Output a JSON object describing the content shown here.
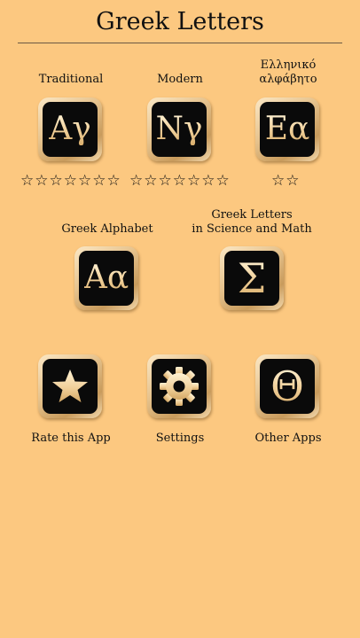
{
  "header": {
    "title": "Greek Letters"
  },
  "row1": [
    {
      "label": "Traditional",
      "glyph": "Αγ",
      "stars": "☆☆☆☆☆☆☆"
    },
    {
      "label": "Modern",
      "glyph": "Νγ",
      "stars": "☆☆☆☆☆☆☆"
    },
    {
      "label_line1": "Ελληνικό",
      "label_line2": "αλφάβητο",
      "glyph": "Εα",
      "stars": "☆☆"
    }
  ],
  "row2": [
    {
      "label": "Greek Alphabet",
      "glyph": "Αα"
    },
    {
      "label_line1": "Greek Letters",
      "label_line2": "in Science and Math",
      "glyph": "Σ"
    }
  ],
  "row3": [
    {
      "label": "Rate this App",
      "icon": "star-icon"
    },
    {
      "label": "Settings",
      "icon": "gear-icon"
    },
    {
      "label": "Other Apps",
      "glyph": "Θ"
    }
  ],
  "colors": {
    "background": "#fcc880",
    "tile_inner": "#0a0a0a",
    "tile_frame": "#e7c48f",
    "glyph_gold": "#f0cf98"
  }
}
